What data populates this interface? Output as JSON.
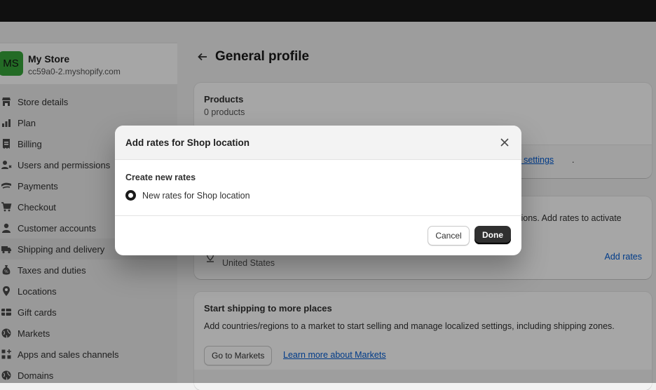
{
  "store": {
    "initials": "MS",
    "name": "My Store",
    "domain": "cc59a0-2.myshopify.com",
    "avatar_color": "#36a53a"
  },
  "sidebar": {
    "items": [
      {
        "label": "Store details",
        "icon": "store-icon"
      },
      {
        "label": "Plan",
        "icon": "plan-icon"
      },
      {
        "label": "Billing",
        "icon": "billing-icon"
      },
      {
        "label": "Users and permissions",
        "icon": "users-icon"
      },
      {
        "label": "Payments",
        "icon": "payments-icon"
      },
      {
        "label": "Checkout",
        "icon": "cart-icon"
      },
      {
        "label": "Customer accounts",
        "icon": "person-icon"
      },
      {
        "label": "Shipping and delivery",
        "icon": "truck-icon",
        "active": true
      },
      {
        "label": "Taxes and duties",
        "icon": "taxes-icon"
      },
      {
        "label": "Locations",
        "icon": "location-icon"
      },
      {
        "label": "Gift cards",
        "icon": "gift-card-icon"
      },
      {
        "label": "Markets",
        "icon": "globe-icon"
      },
      {
        "label": "Apps and sales channels",
        "icon": "apps-icon"
      },
      {
        "label": "Domains",
        "icon": "globe-icon"
      }
    ]
  },
  "main": {
    "title": "General profile",
    "products_card": {
      "heading": "Products",
      "count": "0 products",
      "link_fragment": "ping settings",
      "period": "."
    },
    "zones_card": {
      "text_fragment": "tions. Add rates to activate",
      "country": "United States",
      "add_rates": "Add rates"
    },
    "markets_card": {
      "heading": "Start shipping to more places",
      "text": "Add countries/regions to a market to start selling and manage localized settings, including shipping zones.",
      "button": "Go to Markets",
      "link": "Learn more about Markets"
    }
  },
  "modal": {
    "title": "Add rates for Shop location",
    "section_label": "Create new rates",
    "radio_label": "New rates for Shop location",
    "cancel": "Cancel",
    "done": "Done"
  },
  "colors": {
    "accent_link": "#005bd3",
    "primary_button": "#303030",
    "topbar": "#1a1a1a"
  }
}
